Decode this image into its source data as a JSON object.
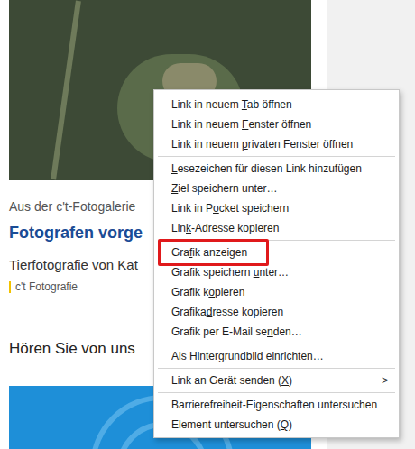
{
  "article": {
    "kicker": "Aus der c't-Fotogalerie",
    "title": "Fotografen vorge",
    "teaser": "Tierfotografie von Kat",
    "tag": "c't Fotografie"
  },
  "section_heading": "Hören Sie von uns",
  "context_menu": {
    "items": [
      {
        "kind": "item",
        "label": "Link in neuem Tab öffnen",
        "underline": 14,
        "highlighted": false
      },
      {
        "kind": "item",
        "label": "Link in neuem Fenster öffnen",
        "underline": 14,
        "highlighted": false
      },
      {
        "kind": "item",
        "label": "Link in neuem privaten Fenster öffnen",
        "underline": 14,
        "highlighted": false
      },
      {
        "kind": "separator"
      },
      {
        "kind": "item",
        "label": "Lesezeichen für diesen Link hinzufügen",
        "underline": 0,
        "highlighted": false
      },
      {
        "kind": "item",
        "label": "Ziel speichern unter…",
        "underline": 0,
        "highlighted": false
      },
      {
        "kind": "item",
        "label": "Link in Pocket speichern",
        "underline": 9,
        "highlighted": false
      },
      {
        "kind": "item",
        "label": "Link-Adresse kopieren",
        "underline": 3,
        "highlighted": false
      },
      {
        "kind": "separator"
      },
      {
        "kind": "item",
        "label": "Grafik anzeigen",
        "underline": 3,
        "highlighted": true
      },
      {
        "kind": "item",
        "label": "Grafik speichern unter…",
        "underline": 17,
        "highlighted": false
      },
      {
        "kind": "item",
        "label": "Grafik kopieren",
        "underline": 8,
        "highlighted": false
      },
      {
        "kind": "item",
        "label": "Grafikadresse kopieren",
        "underline": 7,
        "highlighted": false
      },
      {
        "kind": "item",
        "label": "Grafik per E-Mail senden…",
        "underline": 20,
        "highlighted": false
      },
      {
        "kind": "separator"
      },
      {
        "kind": "item",
        "label": "Als Hintergrundbild einrichten…",
        "underline": 10,
        "highlighted": false
      },
      {
        "kind": "separator"
      },
      {
        "kind": "item",
        "label": "Link an Gerät senden (X)",
        "underline": 22,
        "highlighted": false,
        "arrow": ">"
      },
      {
        "kind": "separator"
      },
      {
        "kind": "item",
        "label": "Barrierefreiheit-Eigenschaften untersuchen",
        "underline": null,
        "highlighted": false
      },
      {
        "kind": "item",
        "label": "Element untersuchen (Q)",
        "underline": 21,
        "highlighted": false
      }
    ]
  }
}
